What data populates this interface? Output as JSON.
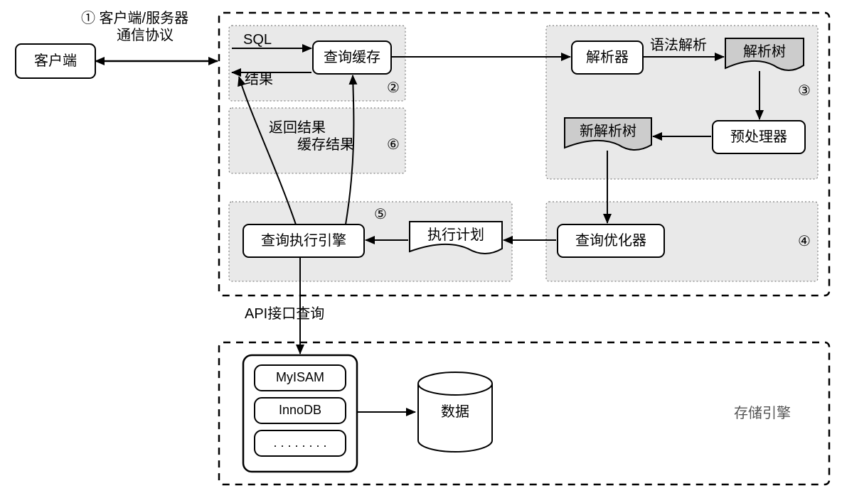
{
  "diagram": {
    "client": "客户端",
    "step1_line1": "① 客户端/服务器",
    "step1_line2": "通信协议",
    "sql_label": "SQL",
    "result_label": "结果",
    "query_cache": "查询缓存",
    "syntax_parsing": "语法解析",
    "parser": "解析器",
    "parse_tree": "解析树",
    "preprocessor": "预处理器",
    "new_parse_tree": "新解析树",
    "query_optimizer": "查询优化器",
    "exec_plan": "执行计划",
    "query_exec_engine": "查询执行引擎",
    "return_result": "返回结果",
    "cache_result": "缓存结果",
    "api_query": "API接口查询",
    "myisam": "MyISAM",
    "innodb": "InnoDB",
    "ellipsis": ". . . . . . . .",
    "data": "数据",
    "storage_engine": "存储引擎",
    "marks": {
      "two": "②",
      "three": "③",
      "four": "④",
      "five": "⑤",
      "six": "⑥"
    }
  }
}
